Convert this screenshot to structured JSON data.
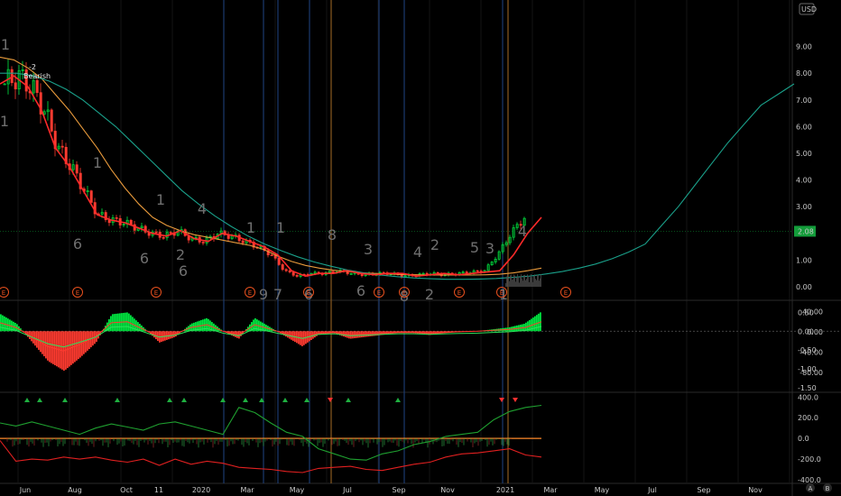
{
  "currency": "USD",
  "last_price_label": "2.08",
  "corner_icons": [
    "A",
    "B"
  ],
  "annotation": {
    "count": "-2",
    "text": "Bearish"
  },
  "x_ticks": [
    "Jun",
    "Aug",
    "Oct",
    "11",
    "2020",
    "Mar",
    "May",
    "Jul",
    "Sep",
    "Nov",
    "2021",
    "Mar",
    "May",
    "Jul",
    "Sep",
    "Nov"
  ],
  "earnings_marker": "E",
  "sequence_counts": [
    "1",
    "1",
    "6",
    "1",
    "6",
    "2",
    "6",
    "4",
    "1",
    "1",
    "9",
    "7",
    "1",
    "6",
    "8",
    "3",
    "6",
    "4",
    "8",
    "2",
    "2",
    "5",
    "3",
    "4",
    "1"
  ],
  "colors": {
    "up": "#00e640",
    "down": "#ff3b30",
    "ma_red": "#ff2a2a",
    "ma_orange": "#e89a3c",
    "ma_teal": "#1aa08a",
    "vline_blue": "#1c3a6e",
    "vline_orange": "#8a5a20"
  },
  "chart_data": [
    {
      "type": "line",
      "pane": "price",
      "ylim": [
        0,
        10
      ],
      "y_ticks": [
        "9.00",
        "8.00",
        "7.00",
        "6.00",
        "5.00",
        "4.00",
        "3.00",
        "2.00",
        "1.00",
        "0.00"
      ],
      "y_tick_values": [
        9,
        8,
        7,
        6,
        5,
        4,
        3,
        2,
        1,
        0
      ],
      "series": [
        {
          "values": [
            7.6,
            7.9,
            7.5,
            6.6,
            5.2,
            4.5,
            3.6,
            2.7,
            2.5,
            2.4,
            2.2,
            2.0,
            1.9,
            2.1,
            1.8,
            1.7,
            2.0,
            1.9,
            1.7,
            1.5,
            1.2,
            0.6,
            0.4,
            0.5,
            0.5,
            0.6,
            0.5,
            0.45,
            0.5,
            0.5,
            0.4,
            0.45,
            0.5,
            0.45,
            0.5,
            0.55,
            0.6,
            1.2,
            2.0,
            2.6
          ]
        },
        {
          "values": [
            8.6,
            8.5,
            8.2,
            7.8,
            7.2,
            6.6,
            5.9,
            5.2,
            4.4,
            3.7,
            3.1,
            2.6,
            2.3,
            2.1,
            1.95,
            1.85,
            1.75,
            1.65,
            1.55,
            1.4,
            1.15,
            0.95,
            0.8,
            0.7,
            0.62,
            0.57,
            0.52,
            0.5,
            0.48,
            0.46,
            0.45,
            0.44,
            0.44,
            0.44,
            0.44,
            0.45,
            0.47,
            0.52,
            0.6,
            0.7
          ]
        },
        {
          "values": [
            8.0,
            8.0,
            7.9,
            7.7,
            7.4,
            7.0,
            6.5,
            6.0,
            5.4,
            4.8,
            4.2,
            3.6,
            3.1,
            2.65,
            2.25,
            1.9,
            1.6,
            1.35,
            1.12,
            0.93,
            0.77,
            0.63,
            0.52,
            0.44,
            0.38,
            0.33,
            0.3,
            0.28,
            0.28,
            0.29,
            0.31,
            0.35,
            0.4,
            0.48,
            0.57,
            0.7,
            0.85,
            1.05,
            1.3,
            1.6,
            2.3,
            3.0,
            3.8,
            4.6,
            5.4,
            6.1,
            6.8,
            7.2,
            7.6
          ]
        }
      ],
      "last_close": 2.08
    },
    {
      "type": "area",
      "pane": "oscillator",
      "ylim": [
        -1.5,
        0.7
      ],
      "y_ticks_left": [
        "0.50",
        "0.00",
        "-0.50",
        "-1.00",
        "-1.50"
      ],
      "y_ticks_left_values": [
        0.5,
        0.0,
        -0.5,
        -1.0,
        -1.5
      ],
      "y_ticks_right": [
        "40.00",
        "0.00",
        "-40.00",
        "-80.00"
      ],
      "y_ticks_right_values": [
        40,
        0,
        -40,
        -80
      ],
      "values": [
        0.45,
        0.2,
        -0.3,
        -0.8,
        -1.05,
        -0.7,
        -0.3,
        0.45,
        0.5,
        0.1,
        -0.3,
        -0.15,
        0.2,
        0.35,
        0.0,
        -0.2,
        0.35,
        0.1,
        -0.15,
        -0.4,
        -0.1,
        -0.05,
        -0.2,
        -0.15,
        -0.1,
        -0.05,
        -0.05,
        -0.1,
        -0.05,
        -0.02,
        0.0,
        0.05,
        0.1,
        0.2,
        0.5
      ]
    },
    {
      "type": "line",
      "pane": "indicator",
      "ylim": [
        -400,
        420
      ],
      "y_ticks": [
        "400.0",
        "200.0",
        "0.0",
        "-200.0",
        "-400.0"
      ],
      "y_tick_values": [
        400,
        200,
        0,
        -200,
        -400
      ],
      "series": [
        {
          "values": [
            150,
            120,
            160,
            120,
            80,
            40,
            100,
            140,
            110,
            80,
            140,
            160,
            120,
            80,
            40,
            300,
            250,
            150,
            60,
            20,
            -100,
            -150,
            -200,
            -210,
            -150,
            -120,
            -60,
            -30,
            20,
            40,
            60,
            180,
            260,
            300,
            320
          ]
        },
        {
          "values": [
            -20,
            -220,
            -200,
            -210,
            -180,
            -200,
            -180,
            -210,
            -230,
            -200,
            -260,
            -200,
            -250,
            -220,
            -240,
            -280,
            -290,
            -300,
            -320,
            -330,
            -290,
            -280,
            -270,
            -300,
            -310,
            -280,
            -250,
            -230,
            -180,
            -150,
            -140,
            -120,
            -100,
            -160,
            -180
          ]
        }
      ]
    }
  ]
}
